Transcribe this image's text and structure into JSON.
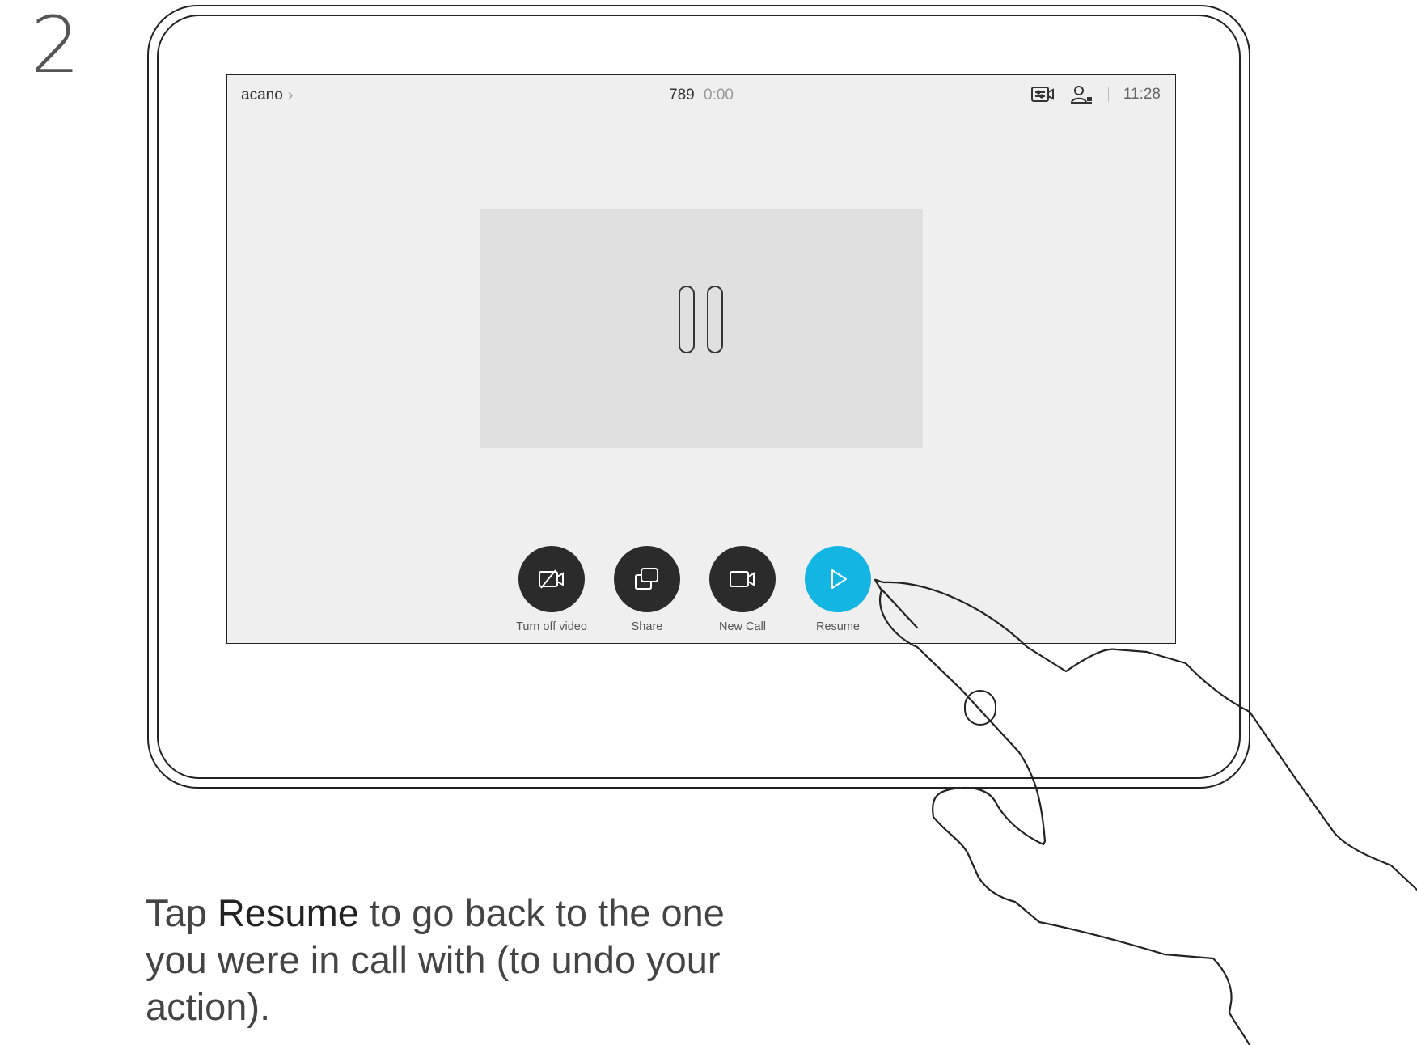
{
  "step_number": "2",
  "screen": {
    "header": {
      "call_name": "acano",
      "call_number": "789",
      "call_duration": "0:00",
      "clock": "11:28"
    },
    "controls": [
      {
        "label": "Turn off video",
        "icon": "video-off-icon",
        "color": "#2b2b2b"
      },
      {
        "label": "Share",
        "icon": "share-icon",
        "color": "#2b2b2b"
      },
      {
        "label": "New Call",
        "icon": "video-camera-icon",
        "color": "#2b2b2b"
      },
      {
        "label": "Resume",
        "icon": "play-icon",
        "color": "#13b6e2"
      }
    ]
  },
  "instruction": {
    "prefix": "Tap",
    "highlight": "Resume",
    "suffix": "to go back to the one you were in call with (to undo your action)."
  }
}
